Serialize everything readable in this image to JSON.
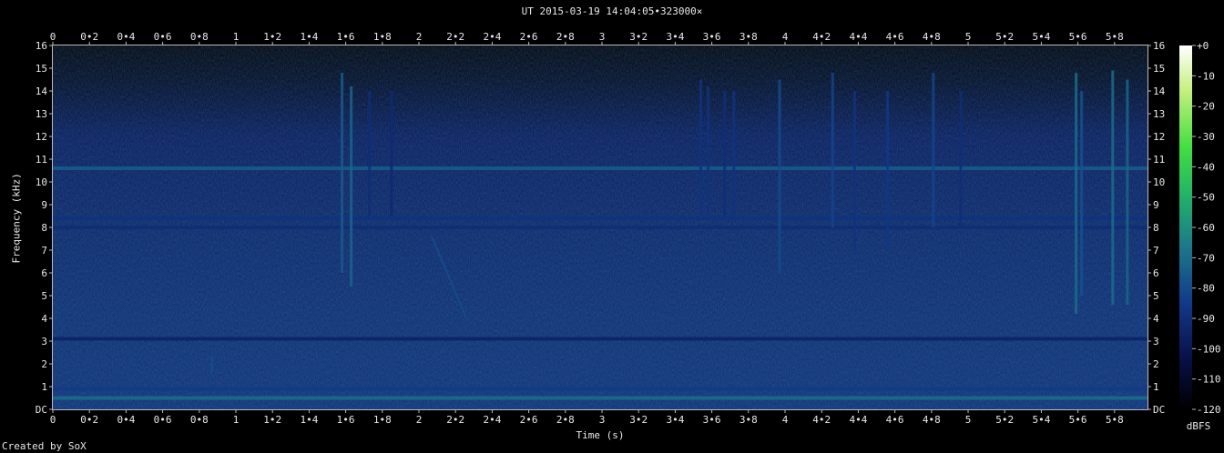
{
  "title": "UT 2015-03-19 14:04:05•323000×",
  "credit": "Created by SoX",
  "colorbar_unit": "dBFS",
  "chart_data": {
    "type": "heatmap",
    "title": "UT 2015-03-19 14:04:05•323000×",
    "xlabel": "Time (s)",
    "ylabel": "Frequency (kHz)",
    "xlim": [
      0,
      5.98
    ],
    "ylim": [
      0,
      16
    ],
    "x_ticks": [
      "0",
      "0•2",
      "0•4",
      "0•6",
      "0•8",
      "1",
      "1•2",
      "1•4",
      "1•6",
      "1•8",
      "2",
      "2•2",
      "2•4",
      "2•6",
      "2•8",
      "3",
      "3•2",
      "3•4",
      "3•6",
      "3•8",
      "4",
      "4•2",
      "4•4",
      "4•6",
      "4•8",
      "5",
      "5•2",
      "5•4",
      "5•6",
      "5•8"
    ],
    "y_ticks": [
      "DC",
      "1",
      "2",
      "3",
      "4",
      "5",
      "6",
      "7",
      "8",
      "9",
      "10",
      "11",
      "12",
      "13",
      "14",
      "15",
      "16"
    ],
    "colorbar": {
      "label": "dBFS",
      "range": [
        -120,
        0
      ],
      "ticks": [
        "+0",
        "-10",
        "-20",
        "-30",
        "-40",
        "-50",
        "-60",
        "-70",
        "-80",
        "-90",
        "-100",
        "-110",
        "-120"
      ],
      "colors": [
        "#000000",
        "#08104a",
        "#123c8c",
        "#1c7a8a",
        "#1fb06a",
        "#40e040",
        "#c8f080",
        "#ffffff"
      ]
    },
    "features": {
      "horizontal_lines_khz": [
        {
          "freq": 10.6,
          "level": -75
        },
        {
          "freq": 8.4,
          "level": -88
        },
        {
          "freq": 8.0,
          "level": -90
        },
        {
          "freq": 0.5,
          "level": -70
        },
        {
          "freq": 0.9,
          "level": -85
        },
        {
          "freq": 3.1,
          "level": -95
        }
      ],
      "vertical_bursts": [
        {
          "t": 1.58,
          "fmin": 6.0,
          "fmax": 14.8,
          "level": -75
        },
        {
          "t": 1.63,
          "fmin": 5.4,
          "fmax": 14.2,
          "level": -72
        },
        {
          "t": 1.73,
          "fmin": 8.5,
          "fmax": 14.0,
          "level": -90
        },
        {
          "t": 1.85,
          "fmin": 8.5,
          "fmax": 14.0,
          "level": -92
        },
        {
          "t": 3.54,
          "fmin": 8.5,
          "fmax": 14.5,
          "level": -88
        },
        {
          "t": 3.58,
          "fmin": 8.5,
          "fmax": 14.2,
          "level": -88
        },
        {
          "t": 3.67,
          "fmin": 8.5,
          "fmax": 14.0,
          "level": -90
        },
        {
          "t": 3.72,
          "fmin": 8.5,
          "fmax": 14.0,
          "level": -88
        },
        {
          "t": 3.97,
          "fmin": 6.0,
          "fmax": 14.5,
          "level": -80
        },
        {
          "t": 4.26,
          "fmin": 8.0,
          "fmax": 14.8,
          "level": -82
        },
        {
          "t": 4.38,
          "fmin": 7.0,
          "fmax": 14.0,
          "level": -88
        },
        {
          "t": 4.56,
          "fmin": 7.0,
          "fmax": 14.0,
          "level": -86
        },
        {
          "t": 4.81,
          "fmin": 8.0,
          "fmax": 14.8,
          "level": -82
        },
        {
          "t": 4.96,
          "fmin": 8.0,
          "fmax": 14.0,
          "level": -90
        },
        {
          "t": 5.59,
          "fmin": 4.2,
          "fmax": 14.8,
          "level": -70
        },
        {
          "t": 5.62,
          "fmin": 5.0,
          "fmax": 14.0,
          "level": -78
        },
        {
          "t": 5.79,
          "fmin": 4.6,
          "fmax": 14.9,
          "level": -70
        },
        {
          "t": 5.87,
          "fmin": 4.6,
          "fmax": 14.5,
          "level": -72
        }
      ],
      "chirp": {
        "t_start": 2.07,
        "f_start": 7.6,
        "t_end": 2.26,
        "f_end": 4.0,
        "level": -80
      },
      "short_burst": {
        "t": 0.87,
        "fmin": 1.6,
        "fmax": 2.3,
        "level": -80
      }
    }
  }
}
